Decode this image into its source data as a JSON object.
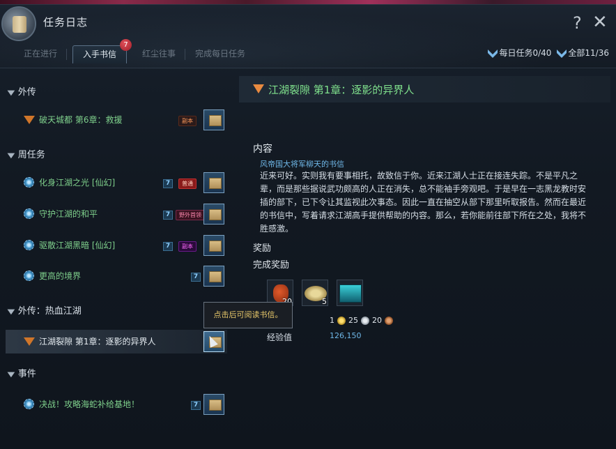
{
  "window": {
    "title": "任务日志",
    "help_glyph": "?",
    "close_glyph": "✕"
  },
  "tabs": [
    {
      "label": "正在进行",
      "active": false
    },
    {
      "label": "入手书信",
      "active": true,
      "badge": "7"
    },
    {
      "label": "红尘往事",
      "active": false
    },
    {
      "label": "完成每日任务",
      "active": false
    }
  ],
  "stats": {
    "daily": "每日任务0/40",
    "all": "全部11/36"
  },
  "categories": [
    {
      "label": "外传",
      "arrow": "▼"
    },
    {
      "label": "周任务",
      "arrow": "▼"
    },
    {
      "label": "外传：热血江湖",
      "arrow": "▼"
    },
    {
      "label": "事件",
      "arrow": "▼"
    }
  ],
  "quests": [
    {
      "label": "破天城都 第6章：救援",
      "icon": "flame-icon",
      "tag": "副本"
    },
    {
      "label": "化身江湖之光 [仙幻]",
      "icon": "gear-icon",
      "count": "7",
      "tag": "普通"
    },
    {
      "label": "守护江湖的和平",
      "icon": "gear-icon",
      "count": "7",
      "tag": "野外首领"
    },
    {
      "label": "驱散江湖黑暗 [仙幻]",
      "icon": "gear-icon",
      "count": "7",
      "tag": "副本"
    },
    {
      "label": "更高的境界",
      "icon": "gear-icon",
      "count": "7"
    },
    {
      "label": "江湖裂隙 第1章：逐影的异界人",
      "icon": "flame-icon",
      "selected": true
    },
    {
      "label": "决战！攻略海蛇补给基地！",
      "icon": "event-icon",
      "count": "7"
    }
  ],
  "tooltip": "点击后可阅读书信。",
  "detail": {
    "title": "江湖裂隙 第1章：逐影的异界人",
    "content_label": "内容",
    "sender": "风帝国大将军柳天的书信",
    "body": "近来可好。实则我有要事相托，故致信于你。近来江湖人士正在接连失踪。不是平凡之辈，而是那些据说武功颇高的人正在消失，总不能袖手旁观吧。于是早在一志黑龙教时安插的部下，已下令让其监视此次事态。因此一直在抽空从部下那里听取报告。然而在最近的书信中，写着请求江湖高手提供帮助的内容。那么，若你能前往部下所在之处，我将不胜感激。",
    "reward_label": "奖励",
    "completion_label": "完成奖励",
    "items": [
      {
        "icon": "potion-icon",
        "count": "20"
      },
      {
        "icon": "food-plate-icon",
        "count": "5"
      },
      {
        "icon": "treasure-chest-icon",
        "count": ""
      }
    ],
    "money": {
      "gold": "1",
      "silver": "25",
      "copper": "20"
    },
    "exp_label": "经验值",
    "exp_value": "126,150"
  }
}
